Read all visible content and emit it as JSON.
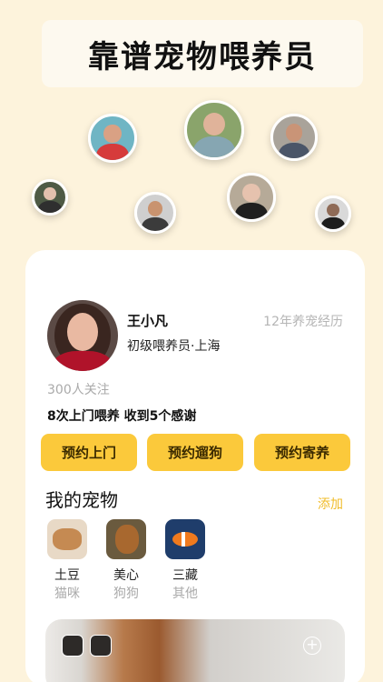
{
  "header": {
    "title": "靠谱宠物喂养员"
  },
  "caregivers": [
    {
      "id": "c1",
      "skin": "#d9a184",
      "hair": "#2b1c17",
      "shirt": "#d63b3b",
      "bg": "#6fb5c4"
    },
    {
      "id": "c2",
      "skin": "#e0b39a",
      "hair": "#2a1f1c",
      "shirt": "#86a6b2",
      "bg": "#8aa46b"
    },
    {
      "id": "c3",
      "skin": "#c99477",
      "hair": "#1c1a1a",
      "shirt": "#4a5568",
      "bg": "#a9a39a"
    },
    {
      "id": "c4",
      "skin": "#e3c0ad",
      "hair": "#2b2320",
      "shirt": "#2f2f2f",
      "bg": "#4e5a45"
    },
    {
      "id": "c5",
      "skin": "#c9936f",
      "hair": "#1a1a1a",
      "shirt": "#3b3b3b",
      "bg": "#cfcfcf"
    },
    {
      "id": "c6",
      "skin": "#e6c2ae",
      "hair": "#3d2c25",
      "shirt": "#1f1f1f",
      "bg": "#b6aa98"
    },
    {
      "id": "c7",
      "skin": "#8f6b57",
      "hair": "#141414",
      "shirt": "#1d1d1d",
      "bg": "#d9d9d9"
    }
  ],
  "profile": {
    "name": "王小凡",
    "experience": "12年养宠经历",
    "role": "初级喂养员·上海",
    "followers": "300人关注",
    "stats": "8次上门喂养  收到5个感谢"
  },
  "actions": [
    "预约上门",
    "预约遛狗",
    "预约寄养"
  ],
  "pets_section": {
    "title": "我的宠物",
    "add_label": "添加",
    "pets": [
      {
        "name": "土豆",
        "type": "猫咪",
        "color": "#c58a52",
        "bg": "#e8d9c6"
      },
      {
        "name": "美心",
        "type": "狗狗",
        "color": "#a8682f",
        "bg": "#6a5a3e"
      },
      {
        "name": "三藏",
        "type": "其他",
        "color": "#f07a1e",
        "bg": "#1f3d6b"
      }
    ]
  },
  "photo_card": {
    "add_icon": "+"
  }
}
